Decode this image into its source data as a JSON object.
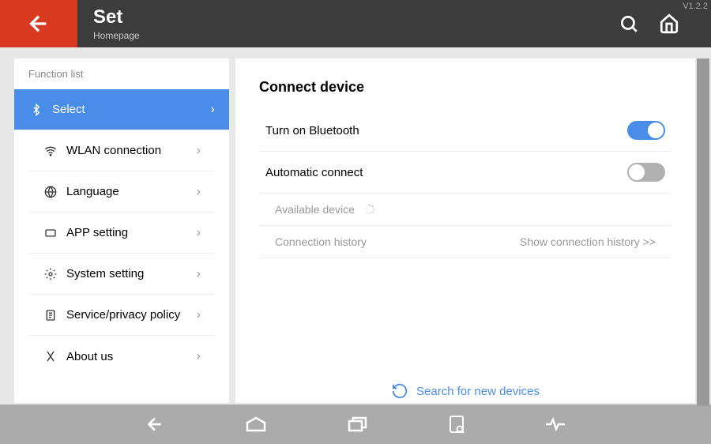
{
  "version": "V1.2.2",
  "header": {
    "title": "Set",
    "subtitle": "Homepage"
  },
  "sidebar": {
    "header": "Function list",
    "items": [
      {
        "label": "Select",
        "icon": "bluetooth",
        "active": true
      },
      {
        "label": "WLAN connection",
        "icon": "wifi"
      },
      {
        "label": "Language",
        "icon": "globe"
      },
      {
        "label": "APP setting",
        "icon": "tablet"
      },
      {
        "label": "System setting",
        "icon": "gear"
      },
      {
        "label": "Service/privacy policy",
        "icon": "document"
      },
      {
        "label": "About us",
        "icon": "about"
      }
    ]
  },
  "main": {
    "title": "Connect device",
    "bluetooth_label": "Turn on Bluetooth",
    "auto_connect_label": "Automatic connect",
    "available_label": "Available device",
    "history_label": "Connection history",
    "show_history_label": "Show connection history >>",
    "search_label": "Search for new devices"
  }
}
